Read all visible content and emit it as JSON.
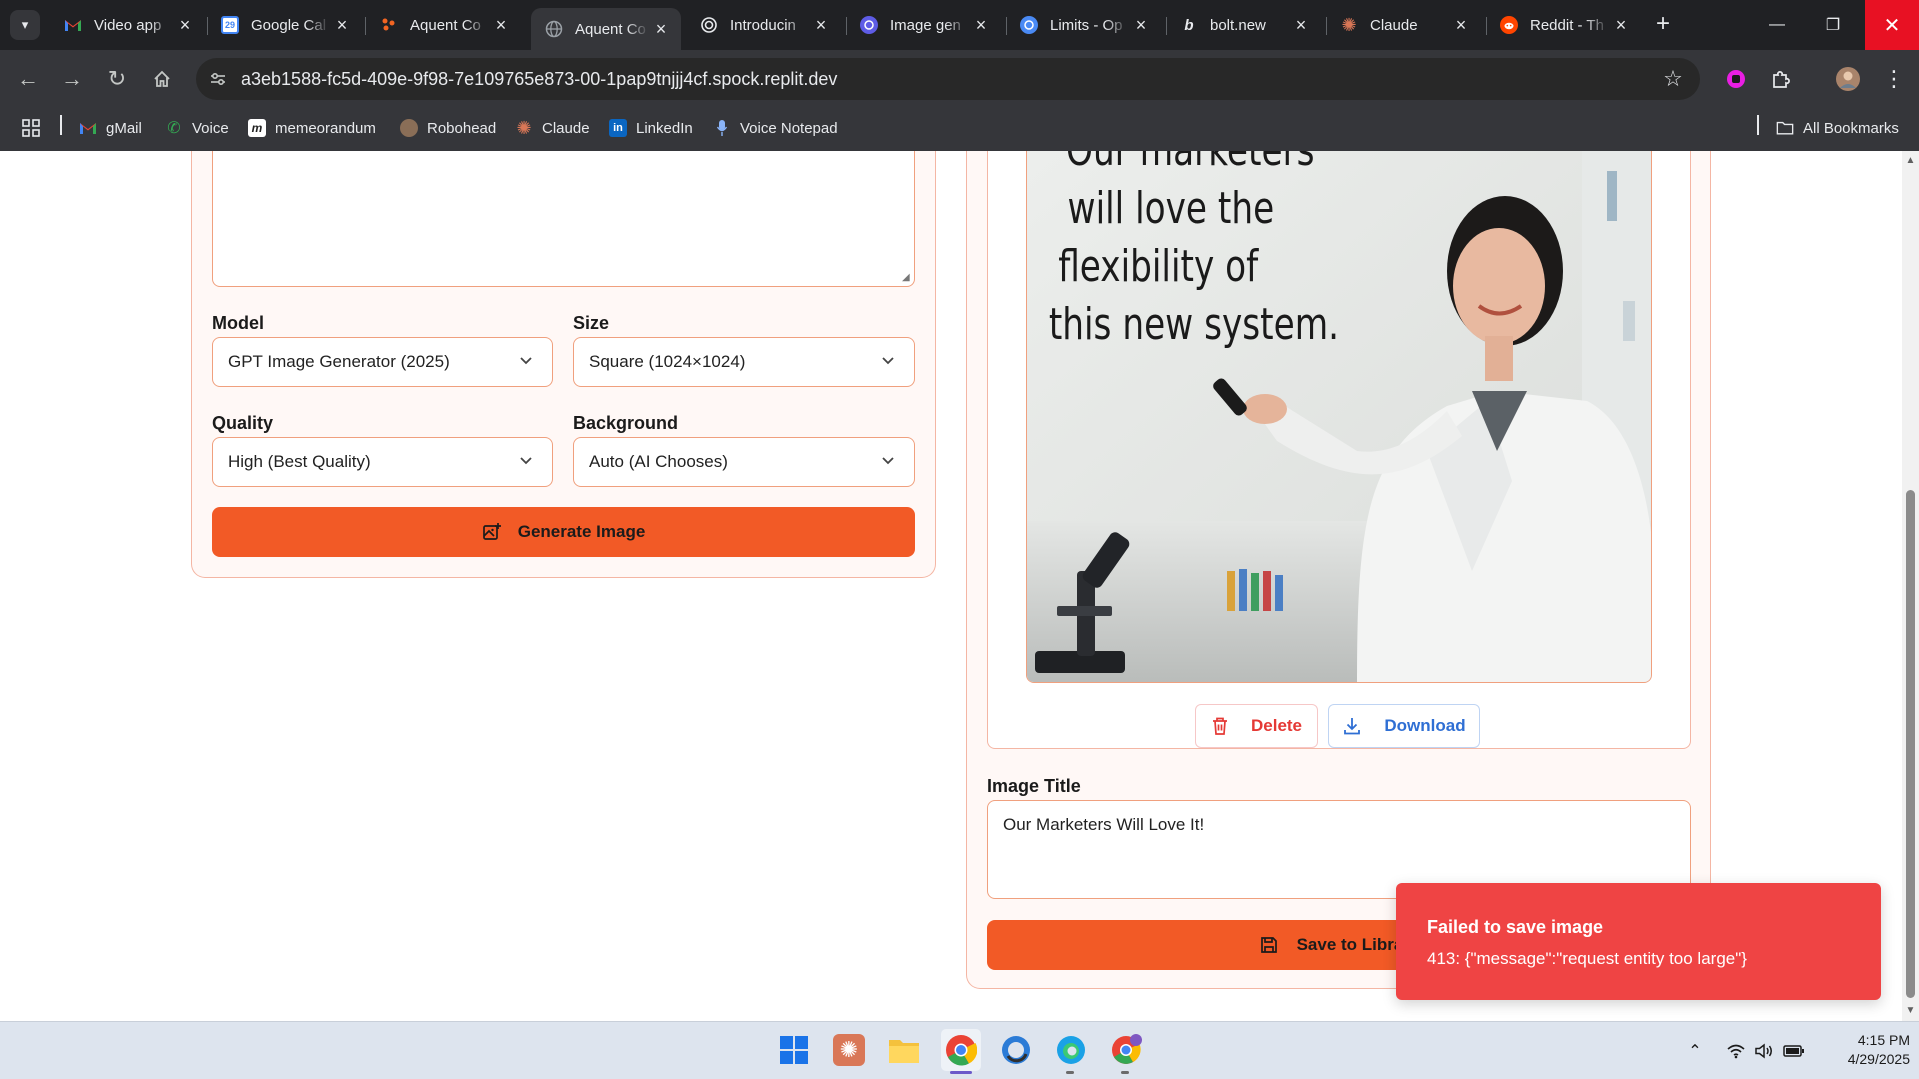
{
  "browser": {
    "tabs": [
      {
        "title": "Video app",
        "icon": "gmail-icon",
        "color": "#ea4335",
        "active": false
      },
      {
        "title": "Google Cal",
        "icon": "google-calendar-icon",
        "color": "#4285f4",
        "active": false
      },
      {
        "title": "Aquent Co",
        "icon": "aquent-icon",
        "color": "#f26522",
        "active": false
      },
      {
        "title": "Aquent Co",
        "icon": "globe-icon",
        "color": "#9aa0a6",
        "active": true
      },
      {
        "title": "Introducin",
        "icon": "openai-icon",
        "color": "#e8eaed",
        "active": false
      },
      {
        "title": "Image gen",
        "icon": "openai-platform-icon",
        "color": "#5e5ce6",
        "active": false
      },
      {
        "title": "Limits - Op",
        "icon": "openai-platform-icon",
        "color": "#4a8af4",
        "active": false
      },
      {
        "title": "bolt.new",
        "icon": "bolt-icon",
        "color": "#e8eaed",
        "active": false
      },
      {
        "title": "Claude",
        "icon": "claude-icon",
        "color": "#d97757",
        "active": false
      },
      {
        "title": "Reddit - Th",
        "icon": "reddit-icon",
        "color": "#ff4500",
        "active": false
      }
    ],
    "url": "a3eb1588-fc5d-409e-9f98-7e109765e873-00-1pap9tnjjj4cf.spock.replit.dev",
    "bookmarks": [
      {
        "label": "gMail",
        "icon": "gmail-icon"
      },
      {
        "label": "Voice",
        "icon": "google-voice-icon"
      },
      {
        "label": "memeorandum",
        "icon": "memeorandum-icon"
      },
      {
        "label": "Robohead",
        "icon": "robohead-icon"
      },
      {
        "label": "Claude",
        "icon": "claude-icon"
      },
      {
        "label": "LinkedIn",
        "icon": "linkedin-icon"
      },
      {
        "label": "Voice Notepad",
        "icon": "microphone-icon"
      }
    ],
    "all_bookmarks": "All Bookmarks"
  },
  "form": {
    "model_label": "Model",
    "model_value": "GPT Image Generator (2025)",
    "size_label": "Size",
    "size_value": "Square (1024×1024)",
    "quality_label": "Quality",
    "quality_value": "High (Best Quality)",
    "background_label": "Background",
    "background_value": "Auto (AI Chooses)",
    "generate_label": "Generate Image"
  },
  "preview": {
    "whiteboard_lines": [
      "Our marketers",
      "will love the",
      "flexibility of",
      "this new system."
    ],
    "delete_label": "Delete",
    "download_label": "Download",
    "title_label": "Image Title",
    "title_value": "Our Marketers Will Love It!",
    "save_label": "Save to Library"
  },
  "toast": {
    "title": "Failed to save image",
    "message": "413: {\"message\":\"request entity too large\"}"
  },
  "taskbar": {
    "time": "4:15 PM",
    "date": "4/29/2025"
  },
  "colors": {
    "accent": "#f25a26",
    "error": "#ef4444",
    "card_border": "#f4b6a4"
  }
}
